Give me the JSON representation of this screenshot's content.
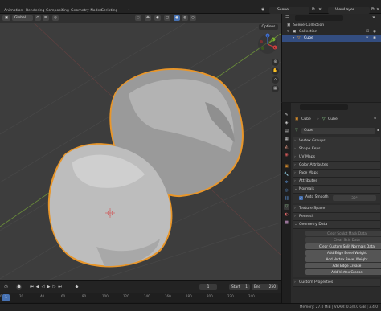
{
  "menu": {
    "tabs": [
      "Animation",
      "Rendering",
      "Compositing",
      "Geometry Nodes",
      "Scripting"
    ],
    "scene_label": "Scene",
    "view_layer_label": "ViewLayer"
  },
  "viewport_header": {
    "transform_orientation": "Global",
    "options_label": "Options",
    "gizmo_axes": [
      "X",
      "Y",
      "Z"
    ]
  },
  "outliner": {
    "rows": [
      {
        "label": "Scene Collection"
      },
      {
        "label": "Collection"
      },
      {
        "label": "Cube"
      }
    ]
  },
  "properties": {
    "object_breadcrumb": [
      "Cube",
      "Cube"
    ],
    "mesh_name": "Cube",
    "panels": [
      "Vertex Groups",
      "Shape Keys",
      "UV Maps",
      "Color Attributes",
      "Face Maps",
      "Attributes",
      "Normals"
    ],
    "auto_smooth_label": "Auto Smooth",
    "auto_smooth_angle": "30°",
    "panels_after": [
      "Texture Space",
      "Remesh",
      "Geometry Data"
    ],
    "geometry_buttons": [
      {
        "label": "Clear Sculpt Mask Data",
        "enabled": false
      },
      {
        "label": "Clear Skin Data",
        "enabled": false
      },
      {
        "label": "Clear Custom Split Normals Data",
        "enabled": true
      },
      {
        "label": "Add Edge Bevel Weight",
        "enabled": true
      },
      {
        "label": "Add Vertex Bevel Weight",
        "enabled": true
      },
      {
        "label": "Add Edge Crease",
        "enabled": true
      },
      {
        "label": "Add Vertex Crease",
        "enabled": true
      }
    ],
    "last_panel": "Custom Properties"
  },
  "timeline": {
    "current_frame": "1",
    "start_label": "Start",
    "start_value": "1",
    "end_label": "End",
    "end_value": "250",
    "ruler": [
      "0",
      "20",
      "40",
      "60",
      "80",
      "100",
      "120",
      "140",
      "160",
      "180",
      "200",
      "220",
      "240"
    ]
  },
  "status": {
    "text": "Memory: 27.0 MiB | VRAM: 0.5/8.0 GiB | 3.4.0"
  },
  "colors": {
    "accent": "#4772b3",
    "selection_outline": "#e8962a",
    "viewport_bg": "#3d3d3d"
  }
}
